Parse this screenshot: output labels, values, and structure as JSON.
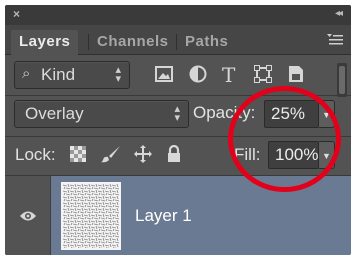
{
  "window": {
    "close_glyph": "×",
    "collapse_glyph": "◂◂"
  },
  "tabs": [
    {
      "label": "Layers",
      "active": true
    },
    {
      "label": "Channels",
      "active": false
    },
    {
      "label": "Paths",
      "active": false
    }
  ],
  "panel_menu_icon": "panel-menu-icon",
  "filter": {
    "kind_label": "Kind",
    "search_icon": "search-icon",
    "filter_icons": [
      "pixel-layer-filter-icon",
      "adjustment-layer-filter-icon",
      "type-layer-filter-icon",
      "shape-layer-filter-icon",
      "smart-object-filter-icon"
    ]
  },
  "blend": {
    "mode_value": "Overlay",
    "opacity_label": "Opacity:",
    "opacity_value": "25%"
  },
  "lock": {
    "label": "Lock:",
    "icons": [
      "lock-transparent-pixels-icon",
      "lock-image-pixels-icon",
      "lock-position-icon",
      "lock-all-icon"
    ],
    "fill_label": "Fill:",
    "fill_value": "100%"
  },
  "layers": [
    {
      "name": "Layer 1",
      "visible": true,
      "selected": true
    }
  ],
  "colors": {
    "panel_bg": "#535353",
    "selected_row": "#6b7a93",
    "annotation_circle": "#e3001b"
  }
}
